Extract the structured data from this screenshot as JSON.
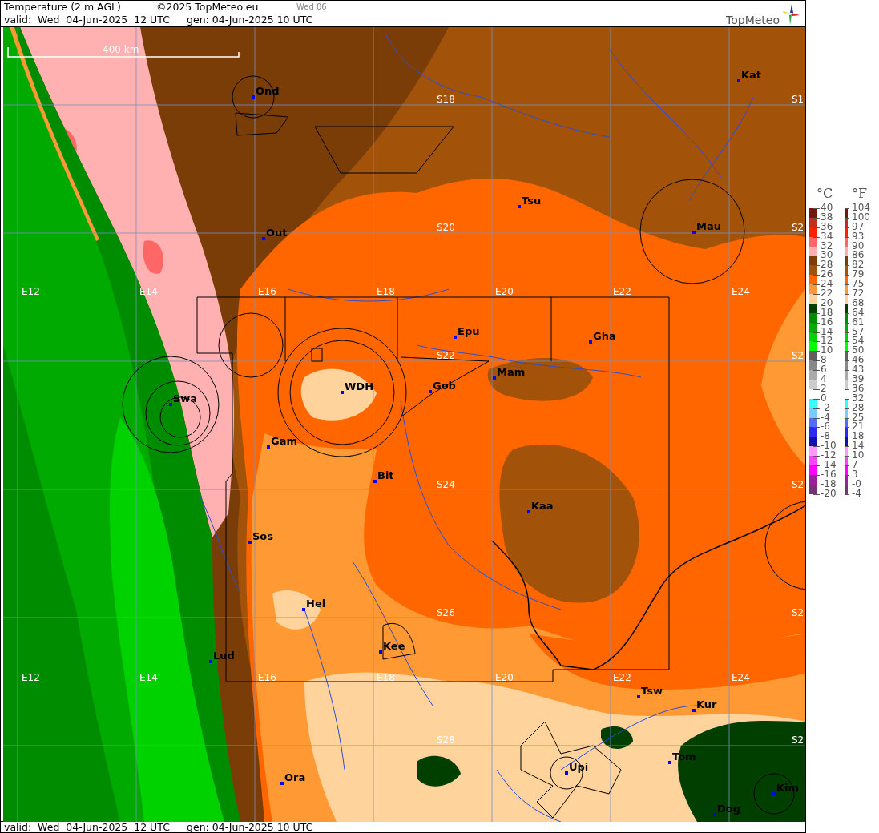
{
  "header": {
    "title": "Temperature (2 m AGL)",
    "copyright": "©2025 TopMeteo.eu",
    "day_tag": "Wed 06",
    "valid": "valid:  Wed  04-Jun-2025  12 UTC",
    "generated": "gen: 04-Jun-2025 10 UTC",
    "logo": "TopMeteo"
  },
  "map": {
    "scale_bar": "400 km",
    "places": [
      "Ond",
      "Kat",
      "Tsu",
      "Out",
      "Mau",
      "Epu",
      "Gha",
      "Mam",
      "Gob",
      "WDH",
      "Swa",
      "Gam",
      "Bit",
      "Kaa",
      "Sos",
      "Hel",
      "Kee",
      "Lud",
      "Tsw",
      "Kur",
      "Tom",
      "Upi",
      "Ora",
      "Kim",
      "Dog"
    ],
    "grid_labels": [
      "E12",
      "E14",
      "E16",
      "E18",
      "E20",
      "E22",
      "E24",
      "E12",
      "E14",
      "E16",
      "E18",
      "E20",
      "E22",
      "E24",
      "S18",
      "S20",
      "S22",
      "S24",
      "S26",
      "S28",
      "S1",
      "S2",
      "S2",
      "S2",
      "S2",
      "S2"
    ]
  },
  "legend": {
    "celsius_header": "°C",
    "fahrenheit_header": "°F",
    "rows": [
      {
        "c": "40",
        "f": "104",
        "color": "#6e1a0e"
      },
      {
        "c": "38",
        "f": "100",
        "color": "#c42c1c"
      },
      {
        "c": "36",
        "f": "97",
        "color": "#ff2200"
      },
      {
        "c": "34",
        "f": "93",
        "color": "#ff6666"
      },
      {
        "c": "32",
        "f": "90",
        "color": "#ffb0b0"
      },
      {
        "c": "30",
        "f": "86",
        "color": "#7a3d08"
      },
      {
        "c": "28",
        "f": "82",
        "color": "#a3520a"
      },
      {
        "c": "26",
        "f": "79",
        "color": "#ff6600"
      },
      {
        "c": "24",
        "f": "75",
        "color": "#ff9933"
      },
      {
        "c": "22",
        "f": "72",
        "color": "#ffd39b"
      },
      {
        "c": "20",
        "f": "68",
        "color": "#003f00"
      },
      {
        "c": "18",
        "f": "64",
        "color": "#008c00"
      },
      {
        "c": "16",
        "f": "61",
        "color": "#00aa00"
      },
      {
        "c": "14",
        "f": "57",
        "color": "#00d200"
      },
      {
        "c": "12",
        "f": "54",
        "color": "#00ff00"
      },
      {
        "c": "10",
        "f": "50",
        "color": "#606060"
      },
      {
        "c": "8",
        "f": "46",
        "color": "#888888"
      },
      {
        "c": "6",
        "f": "43",
        "color": "#aaaaaa"
      },
      {
        "c": "4",
        "f": "39",
        "color": "#cccccc"
      },
      {
        "c": "2",
        "f": "36"
      },
      {
        "c": "0",
        "f": "32",
        "color": "#33ffff"
      },
      {
        "c": "-2",
        "f": "28",
        "color": "#77ccff"
      },
      {
        "c": "-4",
        "f": "25",
        "color": "#4d6eff"
      },
      {
        "c": "-6",
        "f": "21",
        "color": "#2a2aee"
      },
      {
        "c": "-8",
        "f": "18",
        "color": "#1010aa"
      },
      {
        "c": "-10",
        "f": "14",
        "color": "#ff99ff"
      },
      {
        "c": "-12",
        "f": "10",
        "color": "#ff44ff"
      },
      {
        "c": "-14",
        "f": "7",
        "color": "#ff00ff"
      },
      {
        "c": "-16",
        "f": "3",
        "color": "#992299"
      },
      {
        "c": "-18",
        "f": "-0",
        "color": "#773377"
      },
      {
        "c": "-20",
        "f": "-4"
      }
    ]
  },
  "footer": {
    "valid": "valid:  Wed  04-Jun-2025  12 UTC",
    "generated": "gen: 04-Jun-2025 10 UTC"
  }
}
